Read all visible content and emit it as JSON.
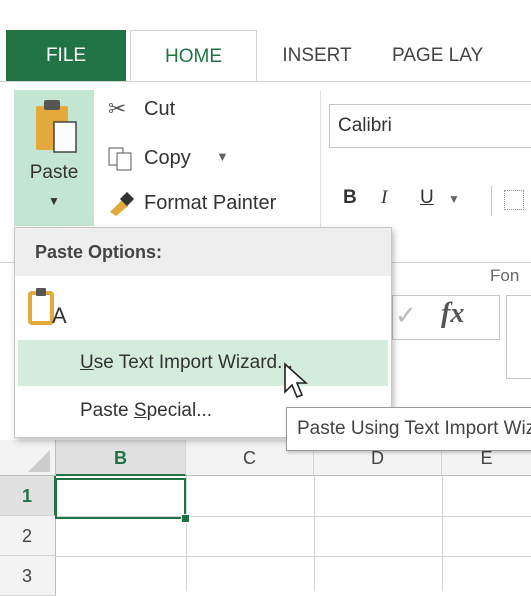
{
  "tabs": {
    "file": "FILE",
    "home": "HOME",
    "insert": "INSERT",
    "page_layout": "PAGE LAY"
  },
  "clipboard": {
    "paste_label": "Paste",
    "cut_label": "Cut",
    "copy_label": "Copy",
    "format_painter_label": "Format Painter"
  },
  "font": {
    "font_name": "Calibri",
    "bold": "B",
    "italic": "I",
    "underline": "U",
    "group_label": "Fon"
  },
  "formula_bar": {
    "fx": "fx"
  },
  "paste_menu": {
    "header": "Paste Options:",
    "keep_text_only_glyph": "A",
    "wizard_key": "U",
    "wizard_rest": "se Text Import Wizard...",
    "special_pre": "Paste ",
    "special_key": "S",
    "special_rest": "pecial..."
  },
  "tooltip": {
    "text": "Paste Using Text Import Wizard"
  },
  "grid": {
    "columns": [
      "B",
      "C",
      "D",
      "E"
    ],
    "rows": [
      "1",
      "2",
      "3"
    ]
  },
  "colors": {
    "accent": "#217346",
    "highlight": "#d3ecdc",
    "paste_button": "#c4e5d2"
  }
}
